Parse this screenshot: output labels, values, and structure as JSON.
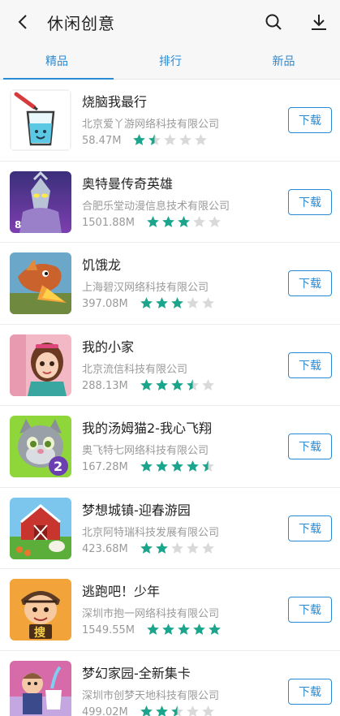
{
  "header": {
    "title": "休闲创意"
  },
  "tabs": [
    {
      "label": "精品",
      "active": true
    },
    {
      "label": "排行",
      "active": false
    },
    {
      "label": "新品",
      "active": false
    }
  ],
  "colors": {
    "accent": "#2a8ad4",
    "star_filled": "#1ba58c",
    "star_empty": "#d9d9d9"
  },
  "apps": [
    {
      "name": "烧脑我最行",
      "company": "北京爱丫游网络科技有限公司",
      "size": "58.47M",
      "rating": 1.5,
      "download_label": "下载",
      "icon": "water-cup-game-icon"
    },
    {
      "name": "奥特曼传奇英雄",
      "company": "合肥乐堂动漫信息技术有限公司",
      "size": "1501.88M",
      "rating": 3,
      "download_label": "下载",
      "icon": "ultraman-icon"
    },
    {
      "name": "饥饿龙",
      "company": "上海碧汉网络科技有限公司",
      "size": "397.08M",
      "rating": 3,
      "download_label": "下载",
      "icon": "dragon-icon"
    },
    {
      "name": "我的小家",
      "company": "北京流信科技有限公司",
      "size": "288.13M",
      "rating": 3.5,
      "download_label": "下载",
      "icon": "girl-character-icon"
    },
    {
      "name": "我的汤姆猫2-我心飞翔",
      "company": "奥飞特七网络科技有限公司",
      "size": "167.28M",
      "rating": 4.5,
      "download_label": "下载",
      "icon": "talking-tom-icon"
    },
    {
      "name": "梦想城镇-迎春游园",
      "company": "北京阿特瑞科技发展有限公司",
      "size": "423.68M",
      "rating": 2,
      "download_label": "下载",
      "icon": "farm-barn-icon"
    },
    {
      "name": "逃跑吧！少年",
      "company": "深圳市抱一网络科技有限公司",
      "size": "1549.55M",
      "rating": 5,
      "download_label": "下载",
      "icon": "runner-boy-icon"
    },
    {
      "name": "梦幻家园-全新集卡",
      "company": "深圳市创梦天地科技有限公司",
      "size": "499.02M",
      "rating": 2.5,
      "download_label": "下载",
      "icon": "butler-toilet-icon"
    }
  ]
}
